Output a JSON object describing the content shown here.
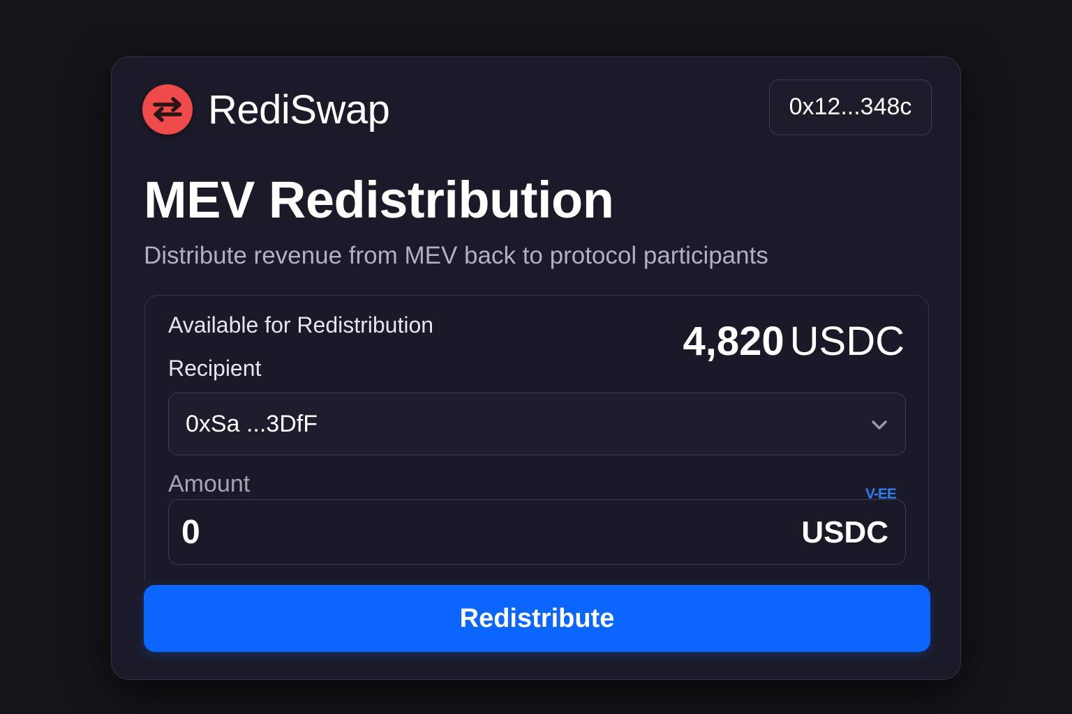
{
  "brand": {
    "name": "RediSwap",
    "logo_icon": "swap-arrows-icon",
    "logo_color": "#ef4b4b"
  },
  "wallet": {
    "address": "0x12...348c"
  },
  "page": {
    "title": "MEV Redistribution",
    "subtitle": "Distribute revenue from MEV back to protocol participants"
  },
  "available": {
    "label": "Available for Redistribution",
    "amount": "4,820",
    "unit": "USDC"
  },
  "recipient": {
    "label": "Recipient",
    "selected": "0xSa ...3DfF",
    "icon": "chevron-down-icon"
  },
  "amount": {
    "label": "Amount",
    "tag": "V-EE",
    "value": "0",
    "unit": "USDC"
  },
  "actions": {
    "redistribute_label": "Redistribute",
    "primary_color": "#0a66ff"
  }
}
